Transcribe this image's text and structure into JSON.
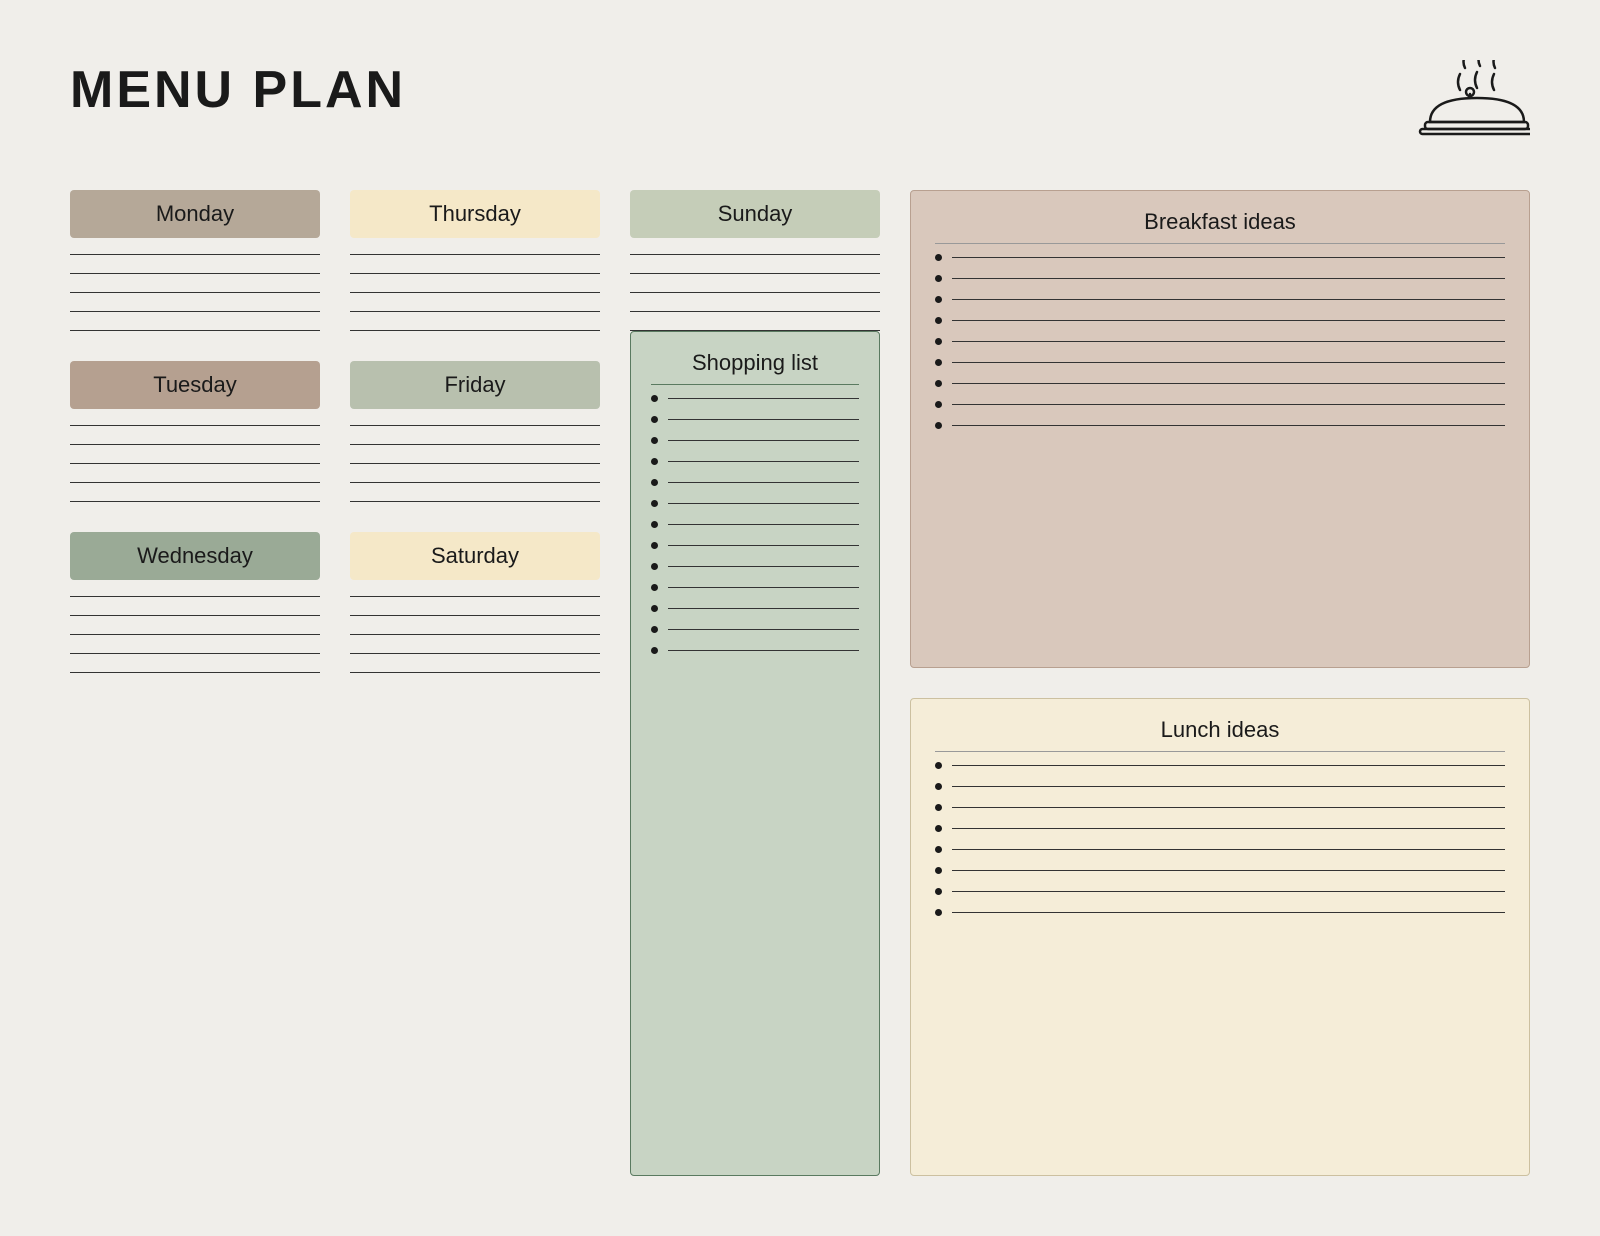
{
  "header": {
    "title": "MENU PLAN"
  },
  "days": {
    "monday": {
      "label": "Monday",
      "color": "color-monday",
      "lines": 5
    },
    "tuesday": {
      "label": "Tuesday",
      "color": "color-tuesday",
      "lines": 5
    },
    "wednesday": {
      "label": "Wednesday",
      "color": "color-wednesday",
      "lines": 5
    },
    "thursday": {
      "label": "Thursday",
      "color": "color-thursday",
      "lines": 5
    },
    "friday": {
      "label": "Friday",
      "color": "color-friday",
      "lines": 5
    },
    "saturday": {
      "label": "Saturday",
      "color": "color-saturday",
      "lines": 5
    },
    "sunday": {
      "label": "Sunday",
      "color": "color-sunday",
      "lines": 5
    }
  },
  "shopping": {
    "title": "Shopping list",
    "items": 13
  },
  "breakfast": {
    "title": "Breakfast ideas",
    "items": 9
  },
  "lunch": {
    "title": "Lunch ideas",
    "items": 8
  }
}
